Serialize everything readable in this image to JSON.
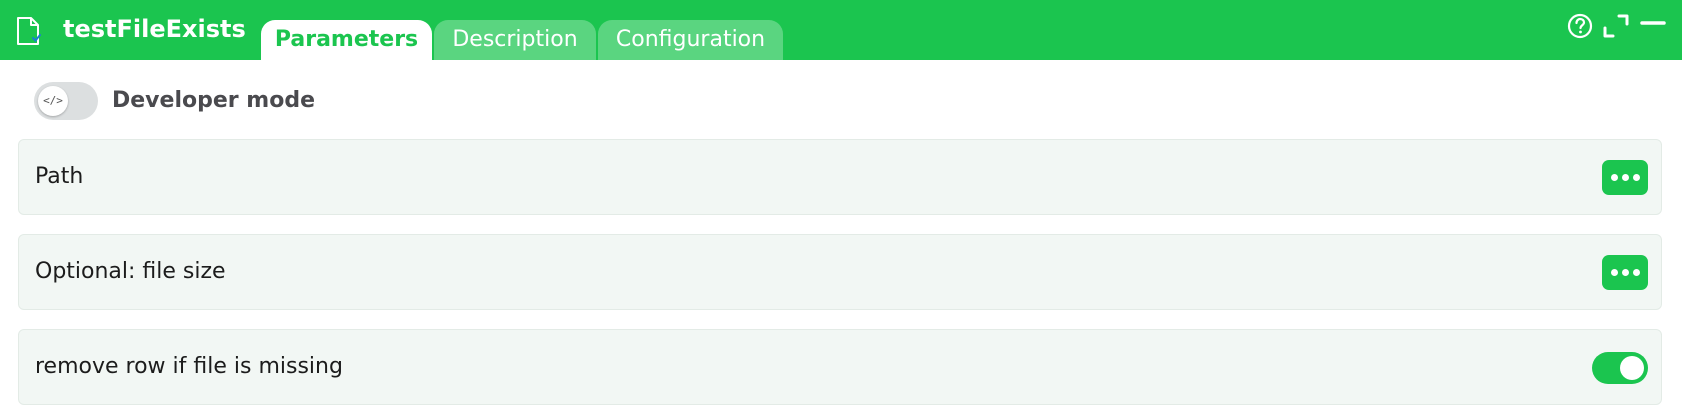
{
  "header": {
    "title": "testFileExists",
    "file_icon": "file-check-icon",
    "tabs": [
      {
        "label": "Parameters",
        "active": true
      },
      {
        "label": "Description",
        "active": false
      },
      {
        "label": "Configuration",
        "active": false
      }
    ],
    "actions": [
      "help-icon",
      "expand-icon",
      "minimize-icon"
    ]
  },
  "developer_mode": {
    "label": "Developer mode",
    "icon_text": "</>",
    "enabled": false
  },
  "parameters": [
    {
      "label": "Path",
      "control": "more-button"
    },
    {
      "label": "Optional: file size",
      "control": "more-button"
    },
    {
      "label": "remove row if file is missing",
      "control": "toggle",
      "value": true
    }
  ],
  "colors": {
    "brand": "#1bc54f",
    "row_background": "#f2f7f4",
    "toggle_off": "#dcdfe0"
  }
}
